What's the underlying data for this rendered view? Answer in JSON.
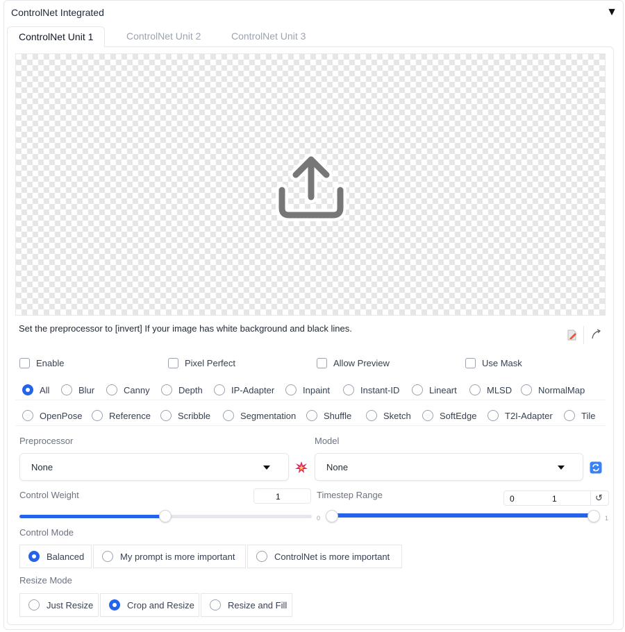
{
  "accordion": {
    "title": "ControlNet Integrated",
    "toggle_glyph": "▼"
  },
  "tabs": [
    {
      "label": "ControlNet Unit 1",
      "active": true
    },
    {
      "label": "ControlNet Unit 2",
      "active": false
    },
    {
      "label": "ControlNet Unit 3",
      "active": false
    }
  ],
  "upload": {
    "icon": "upload-icon"
  },
  "hint": "Set the preprocessor to [invert] If your image has white background and black lines.",
  "toolbar": {
    "icons": [
      "edit-canvas-icon",
      "send-dimensions-icon"
    ]
  },
  "checkboxes": [
    {
      "label": "Enable",
      "checked": false
    },
    {
      "label": "Pixel Perfect",
      "checked": false
    },
    {
      "label": "Allow Preview",
      "checked": false
    },
    {
      "label": "Use Mask",
      "checked": false
    }
  ],
  "control_types": {
    "row1": [
      "All",
      "Blur",
      "Canny",
      "Depth",
      "IP-Adapter",
      "Inpaint",
      "Instant-ID",
      "Lineart",
      "MLSD",
      "NormalMap"
    ],
    "row2": [
      "OpenPose",
      "Reference",
      "Scribble",
      "Segmentation",
      "Shuffle",
      "Sketch",
      "SoftEdge",
      "T2I-Adapter",
      "Tile"
    ],
    "selected": "All"
  },
  "preprocessor": {
    "label": "Preprocessor",
    "value": "None",
    "run_icon": "explosion-icon"
  },
  "model": {
    "label": "Model",
    "value": "None",
    "refresh_icon": "refresh-icon"
  },
  "control_weight": {
    "label": "Control Weight",
    "value": "1",
    "fraction": 0.5
  },
  "timestep_range": {
    "label": "Timestep Range",
    "start": "0",
    "end": "1",
    "min_label": "0",
    "max_label": "1",
    "reset_icon": "reset-icon"
  },
  "control_mode": {
    "label": "Control Mode",
    "options": [
      "Balanced",
      "My prompt is more important",
      "ControlNet is more important"
    ],
    "selected": "Balanced"
  },
  "resize_mode": {
    "label": "Resize Mode",
    "options": [
      "Just Resize",
      "Crop and Resize",
      "Resize and Fill"
    ],
    "selected": "Crop and Resize"
  },
  "colors": {
    "accent": "#2563eb",
    "border": "#e5e7eb",
    "muted_text": "#6b7280"
  }
}
